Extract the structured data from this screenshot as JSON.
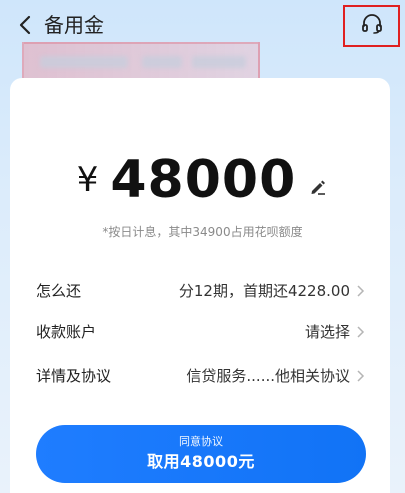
{
  "header": {
    "title": "备用金",
    "back_icon": "back-chevron-icon",
    "service_icon": "headset-icon"
  },
  "loan": {
    "currency": "¥",
    "amount": "48000",
    "note": "*按日计息，其中34900占用花呗额度"
  },
  "rows": [
    {
      "label": "怎么还",
      "value": "分12期，首期还4228.00"
    },
    {
      "label": "收款账户",
      "value": "请选择"
    },
    {
      "label": "详情及协议",
      "value": "信贷服务......他相关协议"
    }
  ],
  "cta": {
    "sub_label": "同意协议",
    "main_label": "取用48000元"
  },
  "colors": {
    "accent": "#1677ff",
    "highlight_border": "#e02020"
  }
}
